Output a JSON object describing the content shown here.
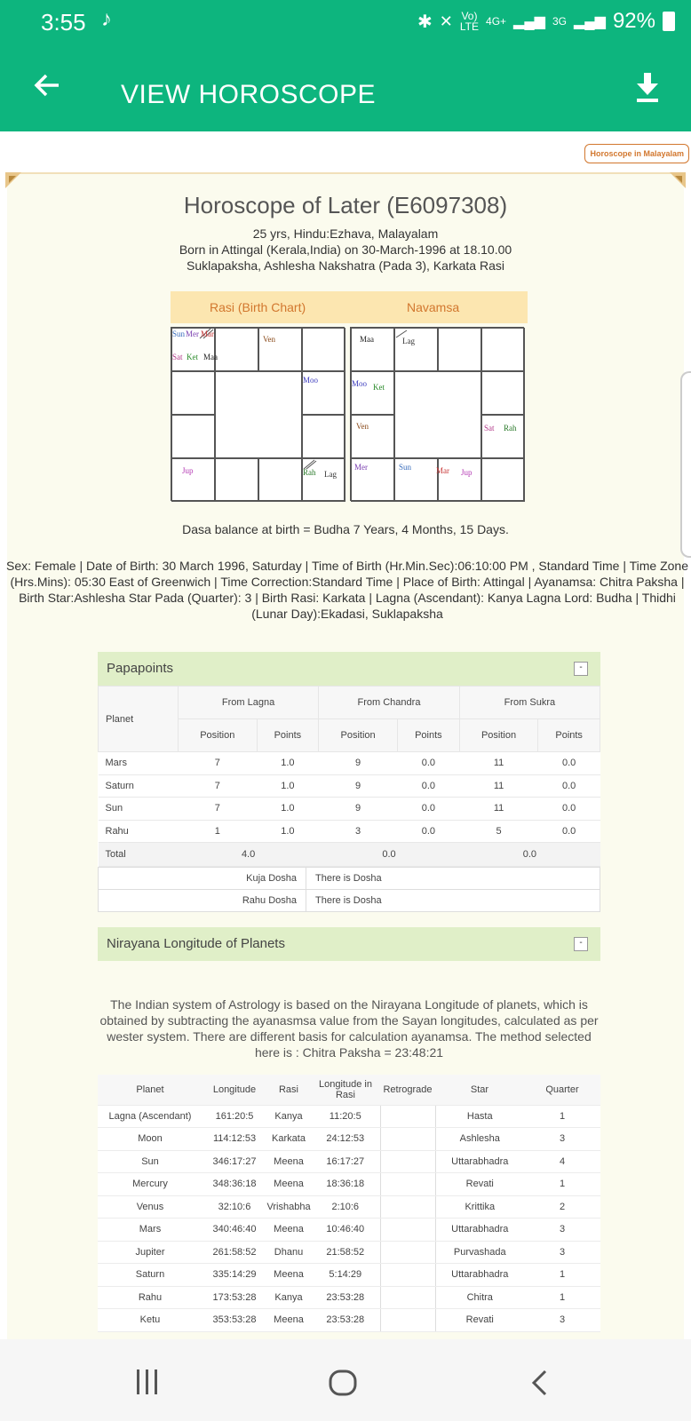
{
  "status": {
    "time": "3:55",
    "net1": "Vo)",
    "net1b": "LTE",
    "net2": "4G+",
    "net3": "3G",
    "battery": "92%"
  },
  "appbar": {
    "title": "VIEW HOROSCOPE"
  },
  "malayalam_button": "Horoscope in Malayalam",
  "header": {
    "title": "Horoscope of  Later (E6097308)",
    "line1": "25 yrs, Hindu:Ezhava, Malayalam",
    "line2": "Born in Attingal (Kerala,India) on 30-March-1996 at 18.10.00",
    "line3": "Suklapaksha, Ashlesha Nakshatra (Pada 3), Karkata Rasi"
  },
  "charts": {
    "rasi_label": "Rasi (Birth Chart)",
    "navamsa_label": "Navamsa"
  },
  "dasa": "Dasa balance at birth = Budha 7 Years, 4 Months, 15 Days.",
  "details": "Sex: Female | Date of Birth: 30 March 1996, Saturday | Time of Birth (Hr.Min.Sec):06:10:00 PM , Standard Time | Time Zone (Hrs.Mins): 05:30 East of Greenwich | Time Correction:Standard Time | Place of Birth: Attingal | Ayanamsa: Chitra Paksha | Birth Star:Ashlesha Star Pada (Quarter): 3 | Birth Rasi: Karkata | Lagna (Ascendant): Kanya Lagna Lord: Budha | Thidhi (Lunar Day):Ekadasi, Suklapaksha",
  "papapoints": {
    "title": "Papapoints",
    "col_planet": "Planet",
    "groups": [
      "From Lagna",
      "From Chandra",
      "From Sukra"
    ],
    "sub": [
      "Position",
      "Points",
      "Position",
      "Points",
      "Position",
      "Points"
    ],
    "rows": [
      [
        "Mars",
        "7",
        "1.0",
        "9",
        "0.0",
        "11",
        "0.0"
      ],
      [
        "Saturn",
        "7",
        "1.0",
        "9",
        "0.0",
        "11",
        "0.0"
      ],
      [
        "Sun",
        "7",
        "1.0",
        "9",
        "0.0",
        "11",
        "0.0"
      ],
      [
        "Rahu",
        "1",
        "1.0",
        "3",
        "0.0",
        "5",
        "0.0"
      ]
    ],
    "total": [
      "Total",
      "4.0",
      "0.0",
      "0.0"
    ],
    "dosha": [
      [
        "Kuja Dosha",
        "There is Dosha"
      ],
      [
        "Rahu Dosha",
        "There is Dosha"
      ]
    ]
  },
  "nirayana": {
    "title": "Nirayana Longitude of Planets",
    "text": "The Indian system of Astrology is based on the Nirayana Longitude of planets, which is obtained by subtracting the ayanasmsa value from the Sayan longitudes, calculated as per wester system. There are different basis for calculation ayanamsa. The method selected here is : Chitra Paksha = 23:48:21",
    "headers": [
      "Planet",
      "Longitude",
      "Rasi",
      "Longitude in Rasi",
      "Retrograde",
      "Star",
      "Quarter"
    ],
    "rows": [
      [
        "Lagna (Ascendant)",
        "161:20:5",
        "Kanya",
        "11:20:5",
        "",
        "Hasta",
        "1"
      ],
      [
        "Moon",
        "114:12:53",
        "Karkata",
        "24:12:53",
        "",
        "Ashlesha",
        "3"
      ],
      [
        "Sun",
        "346:17:27",
        "Meena",
        "16:17:27",
        "",
        "Uttarabhadra",
        "4"
      ],
      [
        "Mercury",
        "348:36:18",
        "Meena",
        "18:36:18",
        "",
        "Revati",
        "1"
      ],
      [
        "Venus",
        "32:10:6",
        "Vrishabha",
        "2:10:6",
        "",
        "Krittika",
        "2"
      ],
      [
        "Mars",
        "340:46:40",
        "Meena",
        "10:46:40",
        "",
        "Uttarabhadra",
        "3"
      ],
      [
        "Jupiter",
        "261:58:52",
        "Dhanu",
        "21:58:52",
        "",
        "Purvashada",
        "3"
      ],
      [
        "Saturn",
        "335:14:29",
        "Meena",
        "5:14:29",
        "",
        "Uttarabhadra",
        "1"
      ],
      [
        "Rahu",
        "173:53:28",
        "Kanya",
        "23:53:28",
        "",
        "Chitra",
        "1"
      ],
      [
        "Ketu",
        "353:53:28",
        "Meena",
        "23:53:28",
        "",
        "Revati",
        "3"
      ]
    ]
  },
  "colors": {
    "primary": "#0db57e",
    "accent": "#d2772e",
    "panel_header": "#e0efc8"
  }
}
